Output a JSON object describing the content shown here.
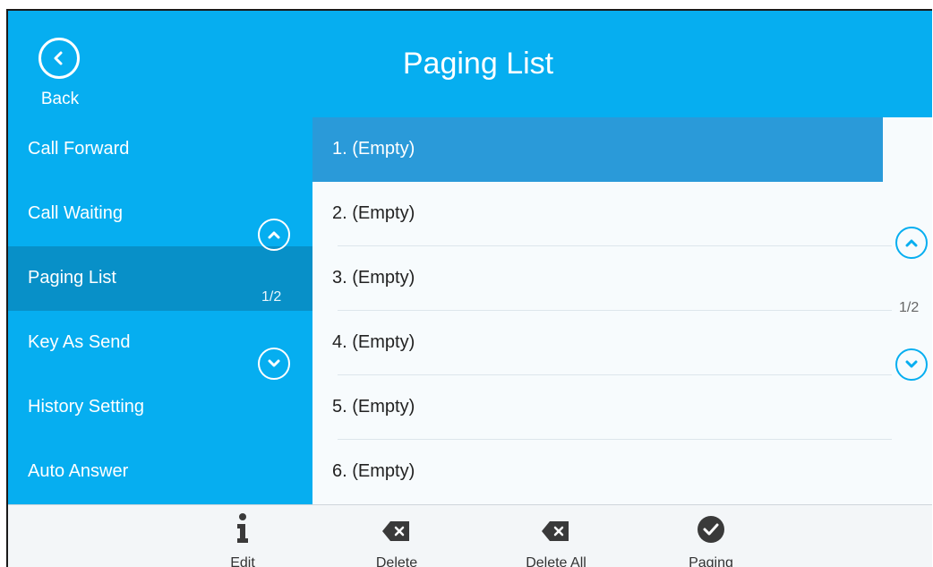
{
  "header": {
    "title": "Paging List",
    "back_label": "Back"
  },
  "sidebar": {
    "items": [
      {
        "label": "Call Forward"
      },
      {
        "label": "Call Waiting"
      },
      {
        "label": "Paging List"
      },
      {
        "label": "Key As Send"
      },
      {
        "label": "History Setting"
      },
      {
        "label": "Auto Answer"
      }
    ],
    "active_index": 2,
    "page_indicator": "1/2"
  },
  "list": {
    "items": [
      {
        "label": "1. (Empty)"
      },
      {
        "label": "2. (Empty)"
      },
      {
        "label": "3. (Empty)"
      },
      {
        "label": "4. (Empty)"
      },
      {
        "label": "5. (Empty)"
      },
      {
        "label": "6. (Empty)"
      }
    ],
    "selected_index": 0,
    "page_indicator": "1/2"
  },
  "softkeys": {
    "edit": {
      "label": "Edit",
      "icon": "info-icon"
    },
    "delete": {
      "label": "Delete",
      "icon": "backspace-icon"
    },
    "delete_all": {
      "label": "Delete All",
      "icon": "backspace-icon"
    },
    "paging": {
      "label": "Paging",
      "icon": "check-circle-icon"
    }
  },
  "colors": {
    "accent": "#06aef0",
    "selected_row": "#2a9ad9",
    "active_sidebar": "#0890c8",
    "softkey_bar": "#f3f6f8"
  }
}
